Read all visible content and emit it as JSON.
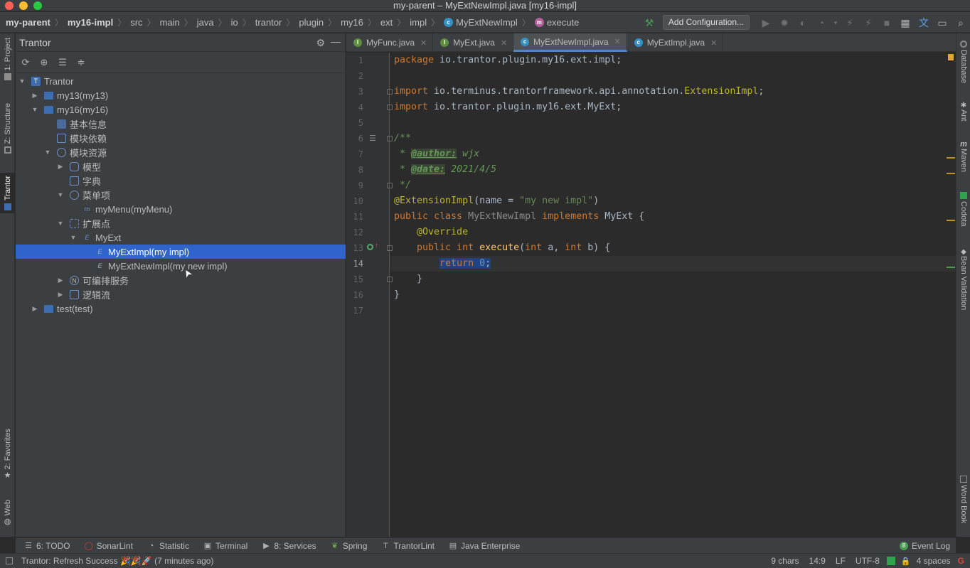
{
  "window": {
    "title": "my-parent – MyExtNewImpl.java [my16-impl]"
  },
  "breadcrumbs": [
    "my-parent",
    "my16-impl",
    "src",
    "main",
    "java",
    "io",
    "trantor",
    "plugin",
    "my16",
    "ext",
    "impl",
    "MyExtNewImpl",
    "execute"
  ],
  "toolbar": {
    "add_configuration": "Add Configuration..."
  },
  "left_strip": {
    "project": "1: Project",
    "structure": "Z: Structure",
    "trantor": "Trantor",
    "favorites": "2: Favorites",
    "web": "Web"
  },
  "right_strip": {
    "database": "Database",
    "ant": "Ant",
    "maven": "Maven",
    "codota": "Codota",
    "bean_validation": "Bean Validation",
    "word_book": "Word Book"
  },
  "panel": {
    "title": "Trantor"
  },
  "tree": [
    {
      "label": "Trantor",
      "depth": 0,
      "arrow": "down",
      "icon": "trantor-icon"
    },
    {
      "label": "my13(my13)",
      "depth": 1,
      "arrow": "right",
      "icon": "folder-icon"
    },
    {
      "label": "my16(my16)",
      "depth": 1,
      "arrow": "down",
      "icon": "folder-icon"
    },
    {
      "label": "基本信息",
      "depth": 2,
      "arrow": "",
      "icon": "info-icon"
    },
    {
      "label": "模块依赖",
      "depth": 2,
      "arrow": "",
      "icon": "dependency-icon"
    },
    {
      "label": "模块资源",
      "depth": 2,
      "arrow": "down",
      "icon": "resource-icon"
    },
    {
      "label": "模型",
      "depth": 3,
      "arrow": "right",
      "icon": "model-icon"
    },
    {
      "label": "字典",
      "depth": 3,
      "arrow": "",
      "icon": "dictionary-icon"
    },
    {
      "label": "菜单项",
      "depth": 3,
      "arrow": "down",
      "icon": "menu-icon"
    },
    {
      "label": "myMenu(myMenu)",
      "depth": 4,
      "arrow": "",
      "icon": "menu-item-icon"
    },
    {
      "label": "扩展点",
      "depth": 3,
      "arrow": "down",
      "icon": "extension-icon"
    },
    {
      "label": "MyExt",
      "depth": 4,
      "arrow": "down",
      "icon": "ext-point-icon"
    },
    {
      "label": "MyExtImpl(my impl)",
      "depth": 5,
      "arrow": "",
      "icon": "ext-impl-icon",
      "selected": true
    },
    {
      "label": "MyExtNewImpl(my new impl)",
      "depth": 5,
      "arrow": "",
      "icon": "ext-impl-icon"
    },
    {
      "label": "可编排服务",
      "depth": 3,
      "arrow": "right",
      "icon": "service-icon"
    },
    {
      "label": "逻辑流",
      "depth": 3,
      "arrow": "right",
      "icon": "flow-icon"
    },
    {
      "label": "test(test)",
      "depth": 1,
      "arrow": "right",
      "icon": "folder-icon"
    }
  ],
  "tabs": [
    {
      "label": "MyFunc.java",
      "kind": "interface",
      "active": false
    },
    {
      "label": "MyExt.java",
      "kind": "interface",
      "active": false
    },
    {
      "label": "MyExtNewImpl.java",
      "kind": "class",
      "active": true
    },
    {
      "label": "MyExtImpl.java",
      "kind": "class",
      "active": false
    }
  ],
  "code": {
    "line_numbers": [
      "1",
      "2",
      "3",
      "4",
      "5",
      "6",
      "7",
      "8",
      "9",
      "10",
      "11",
      "12",
      "13",
      "14",
      "15",
      "16",
      "17"
    ],
    "l1_kw": "package",
    "l1_rest": " io.trantor.plugin.my16.ext.impl;",
    "l3_kw": "import",
    "l3_pkg": " io.terminus.trantorframework.api.annotation.",
    "l3_cls": "ExtensionImpl",
    "l3_end": ";",
    "l4_kw": "import",
    "l4_rest": " io.trantor.plugin.my16.ext.MyExt;",
    "l6": "/**",
    "l7_pre": " * ",
    "l7_tag": "@author:",
    "l7_val": " wjx",
    "l8_pre": " * ",
    "l8_tag": "@date:",
    "l8_val": " 2021/4/5",
    "l9": " */",
    "l10_ann": "@ExtensionImpl",
    "l10_mid": "(name = ",
    "l10_str": "\"my new impl\"",
    "l10_end": ")",
    "l11_kw1": "public class ",
    "l11_cls": "MyExtNewImpl",
    "l11_kw2": " implements ",
    "l11_iface": "MyExt {",
    "l12_ann": "    @Override",
    "l13_kw1": "    public int ",
    "l13_fn": "execute",
    "l13_p1": "(",
    "l13_kw2": "int",
    "l13_p2": " a, ",
    "l13_kw3": "int",
    "l13_p3": " b) {",
    "l14_indent": "        ",
    "l14_kw": "return ",
    "l14_num": "0",
    "l14_end": ";",
    "l15": "    }",
    "l16": "}"
  },
  "bottom_tools": {
    "todo": "6: TODO",
    "sonarlint": "SonarLint",
    "statistic": "Statistic",
    "terminal": "Terminal",
    "services": "8: Services",
    "spring": "Spring",
    "tranorlint": "TrantorLint",
    "java_enterprise": "Java Enterprise",
    "event_log": "Event Log",
    "event_log_count": "8"
  },
  "status": {
    "message": "Trantor: Refresh Success 🎉🎉🚀 (7 minutes ago)",
    "chars": "9 chars",
    "position": "14:9",
    "line_sep": "LF",
    "encoding": "UTF-8",
    "indent": "4 spaces"
  },
  "colors": {
    "selection": "#2f65ca",
    "keyword": "#cc7832",
    "annotation": "#bbb529",
    "string": "#6a8759",
    "doc": "#629755"
  }
}
